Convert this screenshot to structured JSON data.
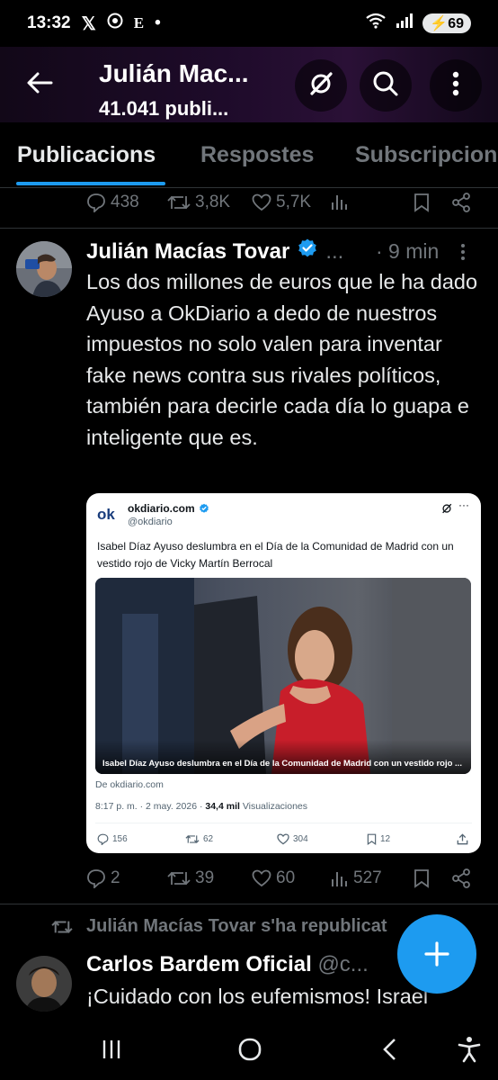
{
  "status_bar": {
    "time": "13:32",
    "notif_x": "𝕏",
    "notif_e": "E",
    "dot": "•",
    "battery": "69"
  },
  "header": {
    "title": "Julián Mac...",
    "subtitle": "41.041 publi..."
  },
  "tabs": [
    {
      "label": "Publicacions",
      "active": true
    },
    {
      "label": "Respostes",
      "active": false
    },
    {
      "label": "Subscripcions",
      "active": false
    }
  ],
  "prev_post_actions": {
    "replies": "438",
    "reposts": "3,8K",
    "likes": "5,7K"
  },
  "post": {
    "author": "Julián Macías Tovar",
    "more": "...",
    "time": "· 9 min",
    "text": "Los dos millones de euros que le ha dado Ayuso a OkDiario a dedo de nuestros impuestos no solo valen para inventar fake news contra sus rivales políticos, también para decirle cada día lo guapa e inteligente que es.",
    "actions": {
      "replies": "2",
      "reposts": "39",
      "likes": "60",
      "views": "527"
    }
  },
  "quoted_card": {
    "logo": "ok",
    "name": "okdiario.com",
    "handle": "@okdiario",
    "more": "···",
    "text": "Isabel Díaz Ayuso deslumbra en el Día de la Comunidad de Madrid con un vestido rojo de Vicky Martín Berrocal",
    "image_caption": "Isabel Díaz Ayuso deslumbra en el Día de la Comunidad de Madrid con un vestido rojo ...",
    "source": "De okdiario.com",
    "time_prefix": "8:17 p. m. · 2 may. 2026 · ",
    "views_count": "34,4 mil",
    "views_label": " Visualizaciones",
    "actions": {
      "replies": "156",
      "reposts": "62",
      "likes": "304",
      "bookmarks": "12"
    }
  },
  "repost_notice": "Julián Macías Tovar s'ha republicat",
  "next_post": {
    "author": "Carlos Bardem Oficial",
    "handle": "@c...",
    "text": "¡Cuidado con los eufemismos! Israel"
  },
  "colors": {
    "accent": "#1d9bf0",
    "background": "#000000",
    "muted": "#71767b",
    "text": "#e7e9ea"
  }
}
